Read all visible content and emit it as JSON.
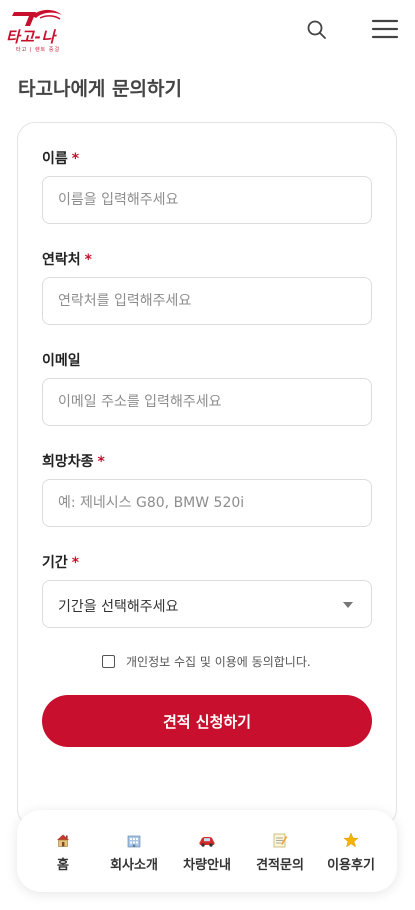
{
  "header": {
    "logo_text": "타고-나",
    "logo_tagline": "타고 | 렌트 중걸",
    "search_icon": "search-icon",
    "menu_icon": "hamburger-menu-icon"
  },
  "page": {
    "title": "타고나에게 문의하기"
  },
  "form": {
    "required_mark": "*",
    "name": {
      "label": "이름",
      "placeholder": "이름을 입력해주세요"
    },
    "contact": {
      "label": "연락처",
      "placeholder": "연락처를 입력해주세요"
    },
    "email": {
      "label": "이메일",
      "placeholder": "이메일 주소를 입력해주세요"
    },
    "car": {
      "label": "희망차종",
      "placeholder": "예: 제네시스 G80, BMW 520i"
    },
    "period": {
      "label": "기간",
      "selected": "기간을 선택해주세요"
    },
    "consent_label": "개인정보 수집 및 이용에 동의합니다.",
    "submit_label": "견적 신청하기"
  },
  "bottom_nav": {
    "items": [
      {
        "label": "홈",
        "icon": "house-icon"
      },
      {
        "label": "회사소개",
        "icon": "building-icon"
      },
      {
        "label": "차량안내",
        "icon": "car-icon"
      },
      {
        "label": "견적문의",
        "icon": "memo-icon"
      },
      {
        "label": "이용후기",
        "icon": "star-icon"
      }
    ]
  },
  "colors": {
    "accent": "#c8102e",
    "text": "#222222",
    "muted": "#8d8d8d",
    "border": "#dcdcdc"
  }
}
